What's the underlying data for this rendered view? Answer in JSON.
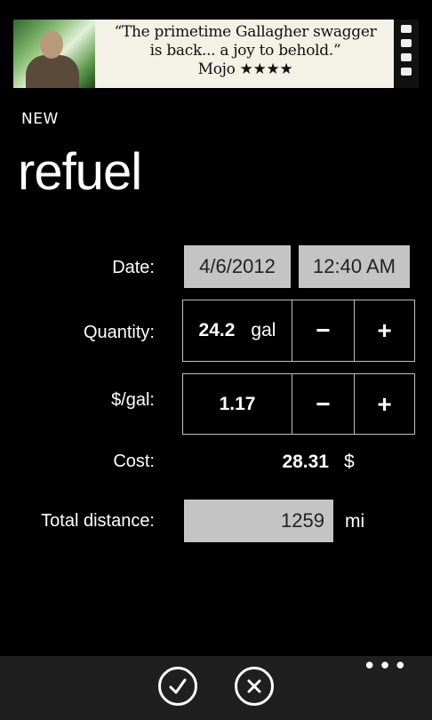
{
  "ad": {
    "quote_line1": "“The primetime Gallagher swagger",
    "quote_line2": "is back... a joy to behold.”",
    "quote_line3": "Mojo ★★★★"
  },
  "header": {
    "subtitle": "NEW",
    "title": "refuel"
  },
  "form": {
    "date": {
      "label": "Date:",
      "date_value": "4/6/2012",
      "time_value": "12:40 AM"
    },
    "quantity": {
      "label": "Quantity:",
      "value": "24.2",
      "unit": "gal",
      "minus": "−",
      "plus": "+"
    },
    "price": {
      "label": "$/gal:",
      "value": "1.17",
      "minus": "−",
      "plus": "+"
    },
    "cost": {
      "label": "Cost:",
      "value": "28.31",
      "unit": "$"
    },
    "distance": {
      "label": "Total distance:",
      "value": "1259",
      "unit": "mi"
    }
  },
  "appbar": {
    "save_icon": "checkmark-icon",
    "cancel_icon": "close-icon",
    "more": "•••"
  }
}
